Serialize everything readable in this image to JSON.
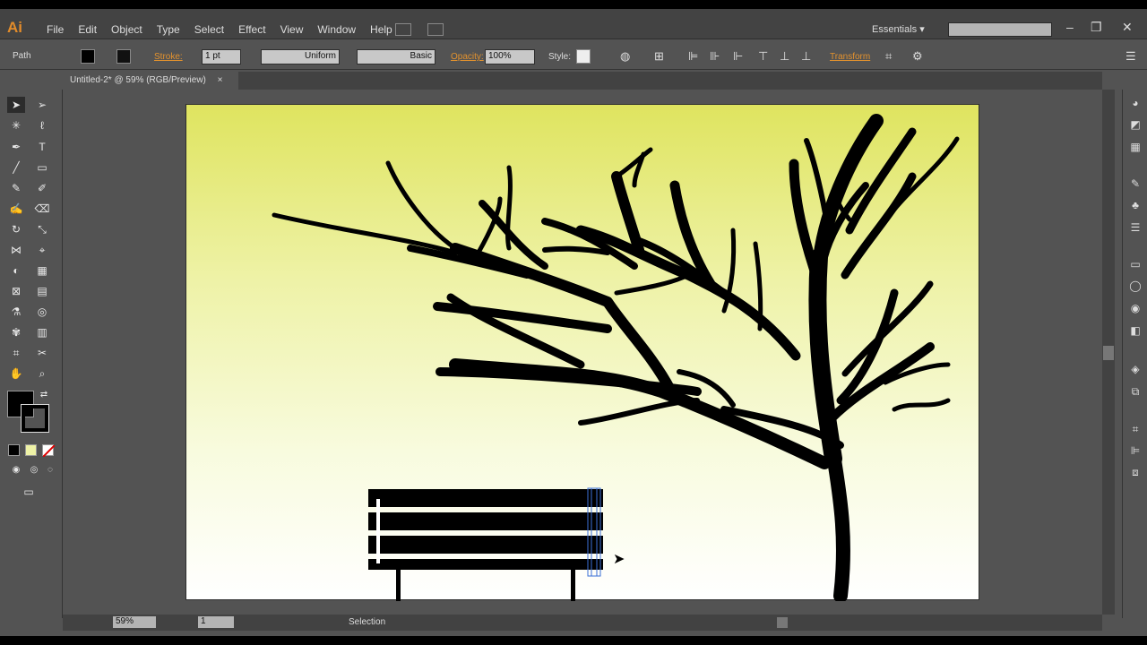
{
  "app": {
    "logo": "Ai"
  },
  "menu": {
    "items": [
      "File",
      "Edit",
      "Object",
      "Type",
      "Select",
      "Effect",
      "View",
      "Window",
      "Help"
    ]
  },
  "workspace": {
    "label": "Essentials"
  },
  "control": {
    "selection_type": "Path",
    "stroke_label": "Stroke:",
    "stroke_weight": "1 pt",
    "profile": "Uniform",
    "brush": "Basic",
    "opacity_label": "Opacity:",
    "opacity_value": "100%",
    "style_label": "Style:",
    "transform_label": "Transform"
  },
  "document": {
    "tab_title": "Untitled-2* @ 59% (RGB/Preview)"
  },
  "status": {
    "zoom": "59%",
    "artboard_number": "1",
    "tool_name": "Selection"
  },
  "colors": {
    "fill": "#000000",
    "stroke": "#000000",
    "accent": "#e3922e",
    "selection": "#3b6fd6"
  }
}
